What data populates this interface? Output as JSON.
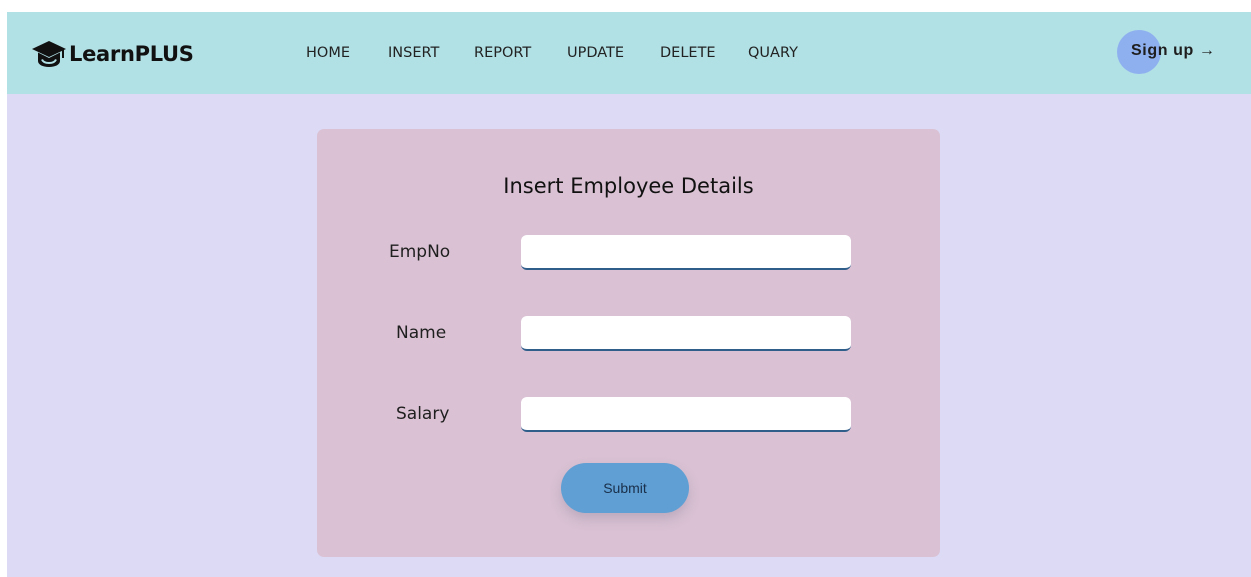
{
  "brand": {
    "name": "LearnPLUS",
    "icon": "graduation-cap-icon"
  },
  "nav": {
    "items": [
      {
        "label": "HOME"
      },
      {
        "label": "INSERT"
      },
      {
        "label": "REPORT"
      },
      {
        "label": "UPDATE"
      },
      {
        "label": "DELETE"
      },
      {
        "label": "QUARY"
      }
    ],
    "signup_label": "Sign up",
    "signup_arrow": "→"
  },
  "form": {
    "title": "Insert Employee Details",
    "fields": [
      {
        "label": "EmpNo",
        "value": ""
      },
      {
        "label": "Name",
        "value": ""
      },
      {
        "label": "Salary",
        "value": ""
      }
    ],
    "submit_label": "Submit"
  },
  "colors": {
    "page_background": "#dcdaf5",
    "navbar_background": "#b1e0e5",
    "card_background": "#dac2d4",
    "submit_button": "#5f9fd3",
    "signup_accent": "#8fb0ef"
  }
}
